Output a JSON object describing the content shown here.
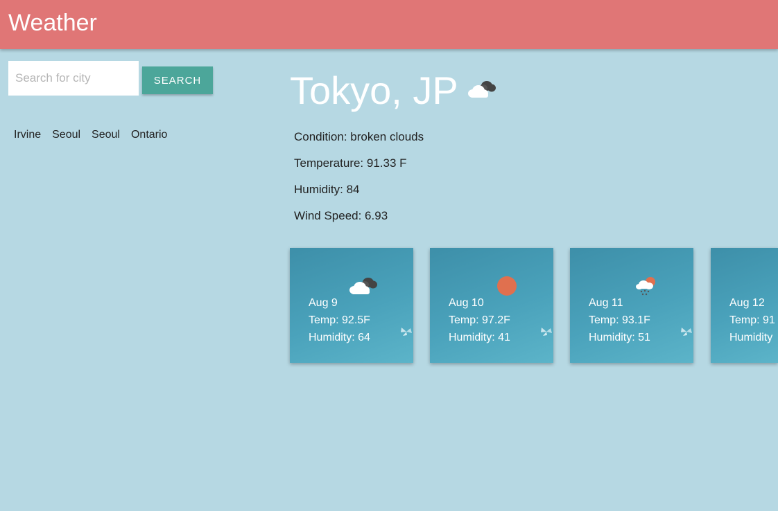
{
  "header": {
    "title": "Weather"
  },
  "search": {
    "placeholder": "Search for city",
    "button_label": "SEARCH"
  },
  "history": [
    "Irvine",
    "Seoul",
    "Seoul",
    "Ontario"
  ],
  "current": {
    "city": "Tokyo, JP",
    "icon": "broken-clouds-icon",
    "condition": "Condition: broken clouds",
    "temperature": "Temperature: 91.33 F",
    "humidity": "Humidity: 84",
    "wind": "Wind Speed: 6.93"
  },
  "forecast": [
    {
      "date": "Aug 9",
      "temp": "Temp: 92.5F",
      "humidity": "Humidity: 64",
      "icon": "broken-clouds-icon"
    },
    {
      "date": "Aug 10",
      "temp": "Temp: 97.2F",
      "humidity": "Humidity: 41",
      "icon": "sun-icon"
    },
    {
      "date": "Aug 11",
      "temp": "Temp: 93.1F",
      "humidity": "Humidity: 51",
      "icon": "sun-rain-cloud-icon"
    },
    {
      "date": "Aug 12",
      "temp": "Temp: 91",
      "humidity": "Humidity",
      "icon": "none"
    }
  ],
  "colors": {
    "navbar": "#e07676",
    "background": "#b6d8e3",
    "search_button": "#4ca69a",
    "card": "#4aa2bb",
    "sun": "#e0704f"
  }
}
